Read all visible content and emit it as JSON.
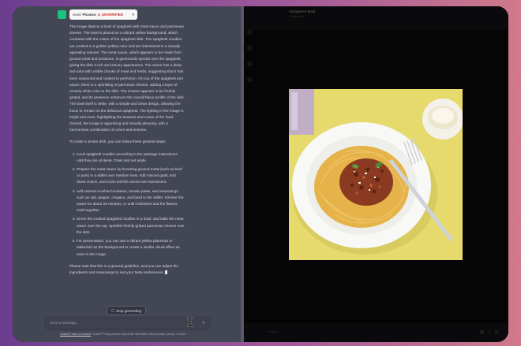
{
  "plugin": {
    "used_label": "Used",
    "plugin_name": "Picasso",
    "status_badge": "UNVERIFIED"
  },
  "message": {
    "intro": "The image depicts a bowl of spaghetti with meat sauce and parmesan cheese. The bowl is placed on a vibrant yellow background, which contrasts with the colors of the spaghetti dish. The spaghetti noodles are cooked to a golden yellow color and are intertwined in a visually appealing manner. The meat sauce, which appears to be made from ground meat and tomatoes, is generously spread over the spaghetti, giving the dish a rich and savory appearance. The sauce has a deep red color with visible chunks of meat and herbs, suggesting that it has been seasoned and cooked to perfection. On top of the spaghetti and sauce, there is a sprinkling of parmesan cheese, adding a layer of creamy white color to the dish. The cheese appears to be freshly grated, and its presence enhances the overall flavor profile of the dish. The bowl itself is white, with a simple and clean design, allowing the focus to remain on the delicious spaghetti. The lighting in the image is bright and even, highlighting the textures and colors of the food. Overall, the image is appetizing and visually pleasing, with a harmonious combination of colors and textures.",
    "steps_intro": "To make a similar dish, you can follow these general steps:",
    "steps": [
      "Cook spaghetti noodles according to the package instructions until they are al dente. Drain and set aside.",
      "Prepare the meat sauce by browning ground meat (such as beef or pork) in a skillet over medium heat. Add minced garlic and diced onions, and cook until the onions are translucent.",
      "Add canned crushed tomatoes, tomato paste, and seasonings such as salt, pepper, oregano, and basil to the skillet. Simmer the sauce for about 20 minutes, or until it thickens and the flavors meld together.",
      "Serve the cooked spaghetti noodles in a bowl, and ladle the meat sauce over the top. Sprinkle freshly grated parmesan cheese over the dish.",
      "For presentation, you can use a vibrant yellow placemat or tablecloth as the background to create a similar visual effect as seen in the image."
    ],
    "closing": "Please note that this is a general guideline, and you can adjust the ingredients and seasonings to suit your taste preferences."
  },
  "stop_button": {
    "label": "Stop generating",
    "icon": "stop-square-icon"
  },
  "composer": {
    "placeholder": "Send a message...",
    "send_icon": "send-icon"
  },
  "footer": {
    "link": "ChatGPT Mar 23 Version",
    "text": ". ChatGPT may produce inaccurate information about people, places, or facts."
  },
  "right_panel": {
    "title": "Bolognese Bowl",
    "subtitle": "Food photo",
    "bottom_label": "Photos",
    "image_subject": "spaghetti bolognese on yellow background",
    "bottom_icons": [
      "grid-icon",
      "share-icon",
      "trash-icon"
    ]
  },
  "colors": {
    "chat_bg": "#434654",
    "accent_green": "#19c37d",
    "badge_red": "#c53030",
    "photo_bg": "#e7da6d"
  }
}
